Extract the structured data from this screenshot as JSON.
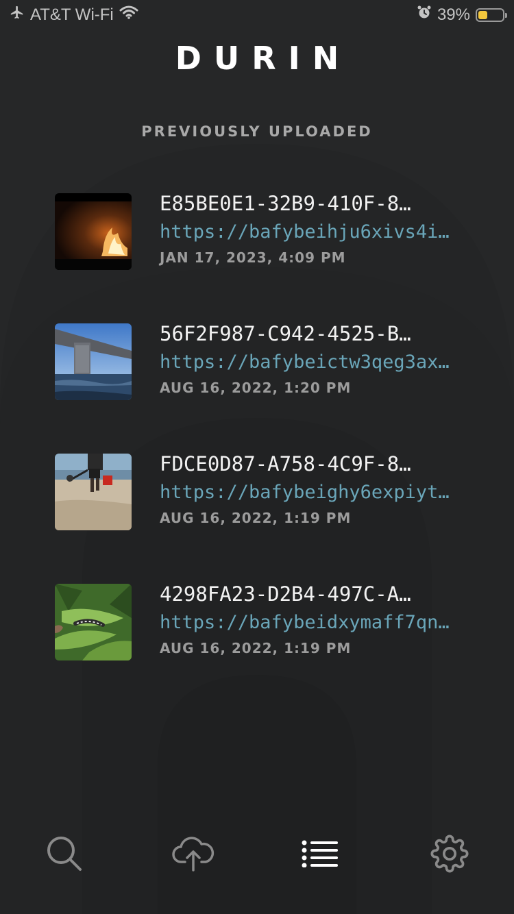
{
  "status_bar": {
    "carrier": "AT&T Wi-Fi",
    "battery_percent": "39%",
    "battery_level": 0.39,
    "icons": [
      "airplane-icon",
      "wifi-icon",
      "alarm-icon",
      "battery-icon"
    ]
  },
  "app": {
    "title": "DURIN"
  },
  "section": {
    "title": "PREVIOUSLY UPLOADED"
  },
  "uploads": [
    {
      "name": "E85BE0E1-32B9-410F-8…",
      "url": "https://bafybeihju6xivs4i…",
      "date": "JAN 17, 2023, 4:09 PM",
      "thumbnail": "fire-at-night"
    },
    {
      "name": "56F2F987-C942-4525-B…",
      "url": "https://bafybeictw3qeg3ax…",
      "date": "AUG 16, 2022, 1:20 PM",
      "thumbnail": "bridge-over-water"
    },
    {
      "name": "FDCE0D87-A758-4C9F-8…",
      "url": "https://bafybeighy6expiyt…",
      "date": "AUG 16, 2022, 1:19 PM",
      "thumbnail": "person-on-beach"
    },
    {
      "name": "4298FA23-D2B4-497C-A…",
      "url": "https://bafybeidxymaff7qn…",
      "date": "AUG 16, 2022, 1:19 PM",
      "thumbnail": "caterpillar-on-leaf"
    }
  ],
  "tab_bar": {
    "tabs": [
      {
        "icon": "search-icon",
        "active": false
      },
      {
        "icon": "cloud-upload-icon",
        "active": false
      },
      {
        "icon": "list-icon",
        "active": true
      },
      {
        "icon": "gear-icon",
        "active": false
      }
    ]
  },
  "colors": {
    "background": "#262728",
    "link": "#6aa6b9",
    "battery": "#f4c83d",
    "tab_inactive": "#8a8a8a",
    "tab_active": "#ffffff"
  }
}
